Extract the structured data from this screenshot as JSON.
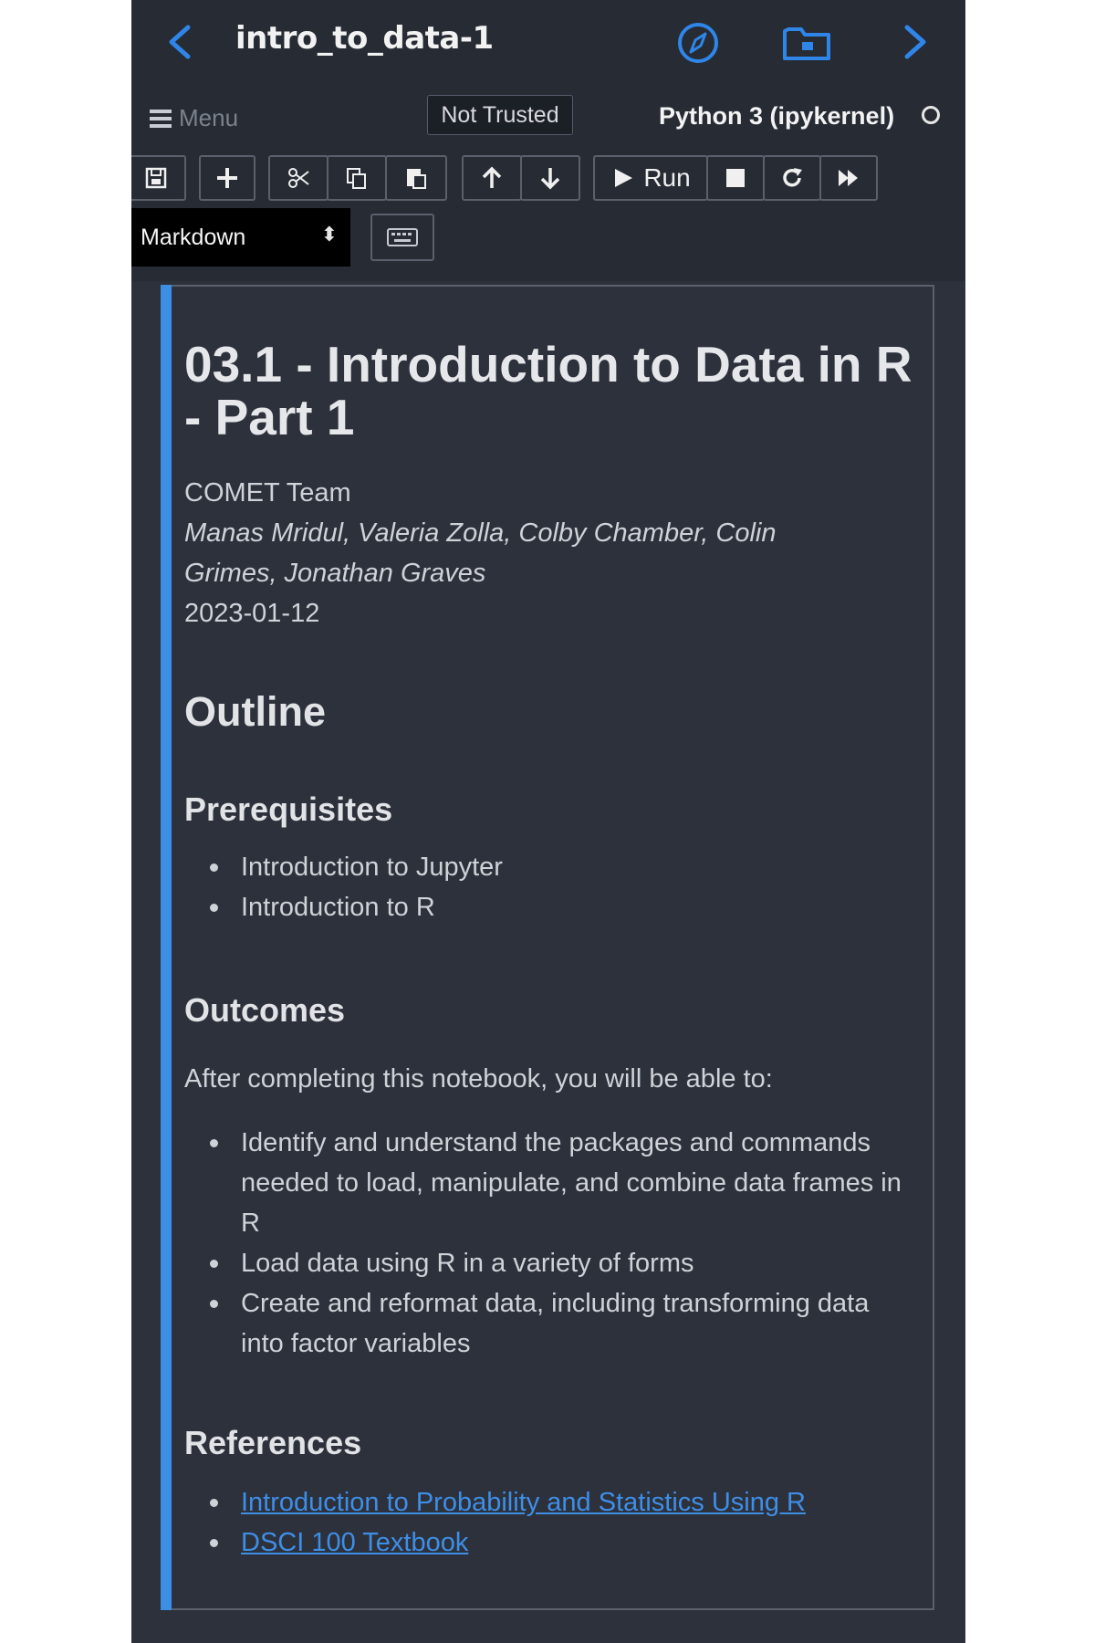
{
  "header": {
    "title": "intro_to_data-1 - Jupyt...",
    "back_icon": "chevron-left-icon",
    "forward_icon": "chevron-right-icon",
    "compass_icon": "compass-icon",
    "folder_icon": "folder-icon",
    "accent_color": "#3c8fe3"
  },
  "menubar": {
    "menu_label": "Menu",
    "trusted_label": "Not Trusted",
    "kernel_label": "Python 3 (ipykernel)"
  },
  "toolbar": {
    "run_label": "Run",
    "cell_type": "Markdown",
    "buttons": [
      "save-icon",
      "plus-icon",
      "scissors-icon",
      "copy-icon",
      "paste-icon",
      "arrow-up-icon",
      "arrow-down-icon",
      "play-icon",
      "stop-icon",
      "restart-icon",
      "fast-forward-icon",
      "keyboard-icon"
    ]
  },
  "cell": {
    "title": "03.1 - Introduction to Data in R - Part 1",
    "team": "COMET Team",
    "authors_line1": "Manas Mridul, Valeria Zolla, Colby Chamber, Colin",
    "authors_line2": "Grimes, Jonathan Graves",
    "date": "2023-01-12",
    "outline_heading": "Outline",
    "prereq_heading": "Prerequisites",
    "prerequisites": [
      "Introduction to Jupyter",
      "Introduction to R"
    ],
    "outcomes_heading": "Outcomes",
    "outcomes_intro": "After completing this notebook, you will be able to:",
    "outcomes": [
      "Identify and understand the packages and commands needed to load, manipulate, and combine data frames in R",
      "Load data using R in a variety of forms",
      "Create and reformat data, including transforming data into factor variables"
    ],
    "references_heading": "References",
    "references": [
      "Introduction to Probability and Statistics Using R",
      "DSCI 100 Textbook"
    ]
  }
}
